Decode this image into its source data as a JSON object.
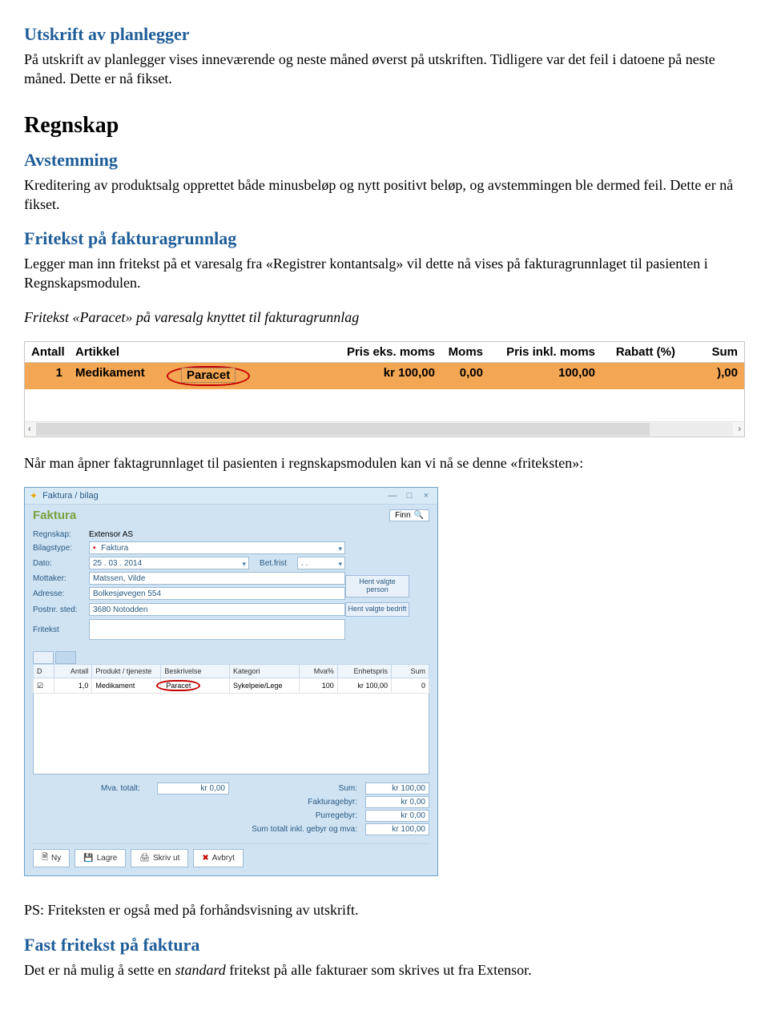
{
  "sec1": {
    "title": "Utskrift av planlegger",
    "body": "På utskrift av planlegger vises inneværende og neste måned øverst på utskriften. Tidligere var det feil i datoene på neste måned. Dette er nå fikset."
  },
  "sec2": {
    "title": "Regnskap"
  },
  "sec3": {
    "title": "Avstemming",
    "body": "Kreditering av produktsalg opprettet både minusbeløp og nytt positivt beløp, og avstemmingen ble dermed feil. Dette er nå fikset."
  },
  "sec4": {
    "title": "Fritekst på fakturagrunnlag",
    "body": "Legger man inn fritekst på et varesalg fra «Registrer kontantsalg» vil dette nå vises på fakturagrunnlaget til pasienten i Regnskapsmodulen.",
    "caption": "Fritekst «Paracet» på varesalg knyttet til fakturagrunnlag"
  },
  "wide": {
    "headers": {
      "antall": "Antall",
      "artikkel": "Artikkel",
      "frit": "",
      "pris_eks": "Pris eks. moms",
      "moms": "Moms",
      "pris_ink": "Pris inkl. moms",
      "rabatt": "Rabatt (%)",
      "sum": "Sum"
    },
    "row": {
      "antall": "1",
      "artikkel": "Medikament",
      "frit": "Paracet",
      "pris_eks": "kr 100,00",
      "moms": "0,00",
      "pris_ink": "100,00",
      "rabatt": "",
      "sum": "),00"
    }
  },
  "sec5": {
    "body": "Når man åpner faktagrunnlaget til pasienten i regnskapsmodulen kan vi nå se denne «friteksten»:"
  },
  "win": {
    "title": "Faktura / bilag",
    "heading": "Faktura",
    "finn": "Finn",
    "labels": {
      "regnskap": "Regnskap:",
      "bilagstype": "Bilagstype:",
      "dato": "Dato:",
      "betfrist": "Bet.frist",
      "mottaker": "Mottaker:",
      "adresse": "Adresse:",
      "postnr": "Postnr. sted:",
      "fritekst": "Fritekst"
    },
    "vals": {
      "regnskap": "Extensor AS",
      "bilagstype": "Faktura",
      "dato": "25 . 03 . 2014",
      "betfrist": ". .",
      "mottaker": "Matssen, Vilde",
      "adresse": "Bolkesjøvegen 554",
      "postnr": "3680 Notodden"
    },
    "side_btns": {
      "person": "Hent valgte person",
      "bedrift": "Hent valgte bedrift"
    },
    "itm_headers": {
      "chk": "D",
      "antall": "Antall",
      "produkt": "Produkt / tjeneste",
      "beskr": "Beskrivelse",
      "kategori": "Kategori",
      "mva": "Mva%",
      "enhet": "Enhetspris",
      "sum": "Sum"
    },
    "itm_row": {
      "chk": "☑",
      "antall": "1,0",
      "produkt": "Medikament",
      "beskr": "Paracet",
      "kategori": "Sykelpeie/Lege",
      "mva": "100",
      "enhet": "kr 100,00",
      "sum": "0"
    },
    "totals": {
      "mva_lbl": "Mva. totalt:",
      "mva_val": "kr 0,00",
      "sum_lbl": "Sum:",
      "sum_val": "kr 100,00",
      "gebyr_lbl": "Fakturagebyr:",
      "gebyr_val": "kr 0,00",
      "purre_lbl": "Purregebyr:",
      "purre_val": "kr 0,00",
      "total_lbl": "Sum totalt inkl. gebyr og mva:",
      "total_val": "kr 100,00"
    },
    "btns": {
      "ny": "Ny",
      "lagre": "Lagre",
      "skriv": "Skriv ut",
      "avbryt": "Avbryt"
    }
  },
  "sec6": {
    "body": "PS: Friteksten er også med på forhåndsvisning av utskrift."
  },
  "sec7": {
    "title": "Fast fritekst på faktura",
    "body_pre": "Det er nå mulig å sette en ",
    "body_em": "standard",
    "body_post": " fritekst på alle fakturaer som skrives ut fra Extensor."
  }
}
